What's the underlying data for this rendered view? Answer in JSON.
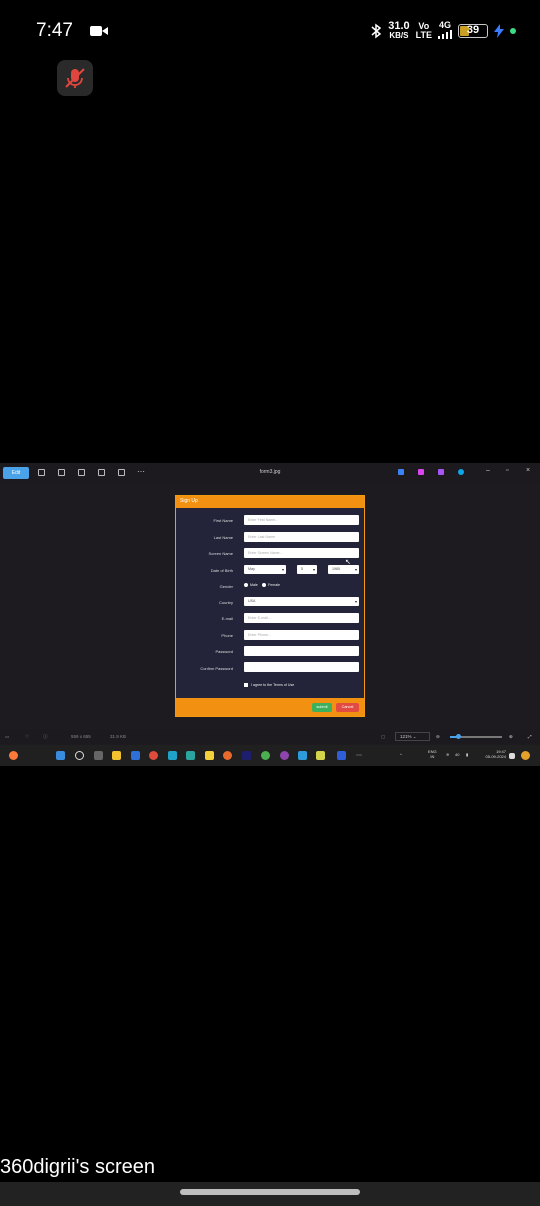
{
  "status_bar": {
    "time": "7:47",
    "speed_value": "31.0",
    "speed_unit": "KB/S",
    "volte_top": "Vo",
    "volte_bottom": "LTE",
    "network": "4G",
    "battery": "39",
    "battery_color": "#c9a024"
  },
  "viewer": {
    "edit_label": "Edit",
    "file_name": "form3.jpg",
    "bottom_info": "559 x 655",
    "bottom_size": "31.9 KB",
    "zoom": "121%",
    "zoom_level_fraction": 0.17
  },
  "form": {
    "title": "Sign Up",
    "fields": [
      {
        "label": "First Name",
        "placeholder": "Enter First Name..."
      },
      {
        "label": "Last Name",
        "placeholder": "Enter Last Name"
      },
      {
        "label": "Screen Name",
        "placeholder": "Enter Screen Name..."
      }
    ],
    "dob_label": "Date of Birth",
    "dob_month": "May",
    "dob_day": "5",
    "dob_year": "1985",
    "gender_label": "Gender",
    "gender_male": "Male",
    "gender_female": "Female",
    "country_label": "Country",
    "country_value": "USA",
    "email_label": "E-mail",
    "email_placeholder": "Enter E-mail...",
    "phone_label": "Phone",
    "phone_placeholder": "Enter Phone...",
    "password_label": "Password",
    "confirm_label": "Confirm Password",
    "terms": "I agree to the Terms of Use",
    "submit": "submit",
    "cancel": "Cancel",
    "accent_color": "#f29111"
  },
  "taskbar": {
    "lang_top": "ENG",
    "lang_bottom": "IN",
    "volume": "40",
    "clock_time": "19:47",
    "clock_date": "05-09-2024"
  },
  "caption": "360digrii's screen"
}
